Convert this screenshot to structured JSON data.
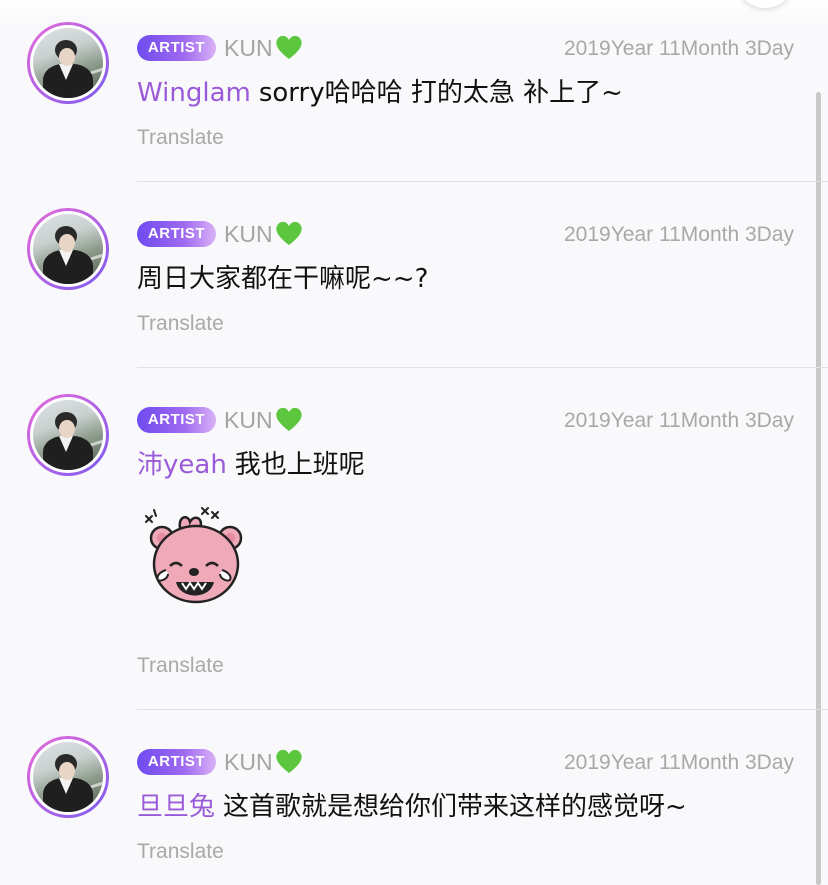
{
  "colors": {
    "background": "#f9f9fb",
    "badge_gradient_start": "#6f4bf0",
    "badge_gradient_end": "#d9b2f7",
    "mention": "#9a5bd9",
    "meta_text": "#a8a8a8",
    "divider": "#e1e1e4"
  },
  "messages": [
    {
      "badge": "ARTIST",
      "author": "KUN",
      "author_icon": "green-heart-icon",
      "time": "2019Year 11Month 3Day",
      "mention": "Winglam",
      "text": "sorry哈哈哈 打的太急 补上了~",
      "translate": "Translate"
    },
    {
      "badge": "ARTIST",
      "author": "KUN",
      "author_icon": "green-heart-icon",
      "time": "2019Year 11Month 3Day",
      "mention": "",
      "text": "周日大家都在干嘛呢~~?",
      "translate": "Translate"
    },
    {
      "badge": "ARTIST",
      "author": "KUN",
      "author_icon": "green-heart-icon",
      "time": "2019Year 11Month 3Day",
      "mention": "沛yeah",
      "text": "我也上班呢",
      "sticker": "crying-pink-bear-sticker",
      "translate": "Translate"
    },
    {
      "badge": "ARTIST",
      "author": "KUN",
      "author_icon": "green-heart-icon",
      "time": "2019Year 11Month 3Day",
      "mention": "旦旦兔",
      "text": "这首歌就是想给你们带来这样的感觉呀~",
      "translate": "Translate"
    }
  ]
}
